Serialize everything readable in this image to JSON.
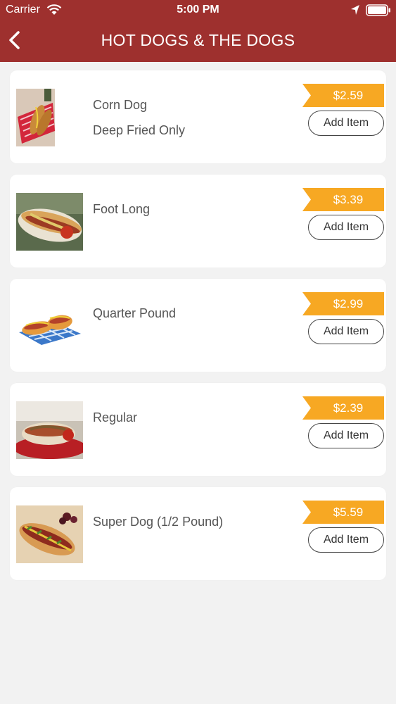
{
  "status_bar": {
    "carrier": "Carrier",
    "time": "5:00 PM"
  },
  "nav": {
    "title": "HOT DOGS & THE DOGS",
    "back_icon": "chevron-left-icon"
  },
  "colors": {
    "header": "#9e302e",
    "price_tag": "#f7a823",
    "background": "#f2f2f2"
  },
  "menu_items": [
    {
      "name": "Corn Dog",
      "description": "Deep Fried Only",
      "price": "$2.59",
      "button": "Add Item"
    },
    {
      "name": "Foot Long",
      "description": "",
      "price": "$3.39",
      "button": "Add Item"
    },
    {
      "name": "Quarter Pound",
      "description": "",
      "price": "$2.99",
      "button": "Add Item"
    },
    {
      "name": "Regular",
      "description": "",
      "price": "$2.39",
      "button": "Add Item"
    },
    {
      "name": "Super Dog (1/2 Pound)",
      "description": "",
      "price": "$5.59",
      "button": "Add Item"
    }
  ]
}
